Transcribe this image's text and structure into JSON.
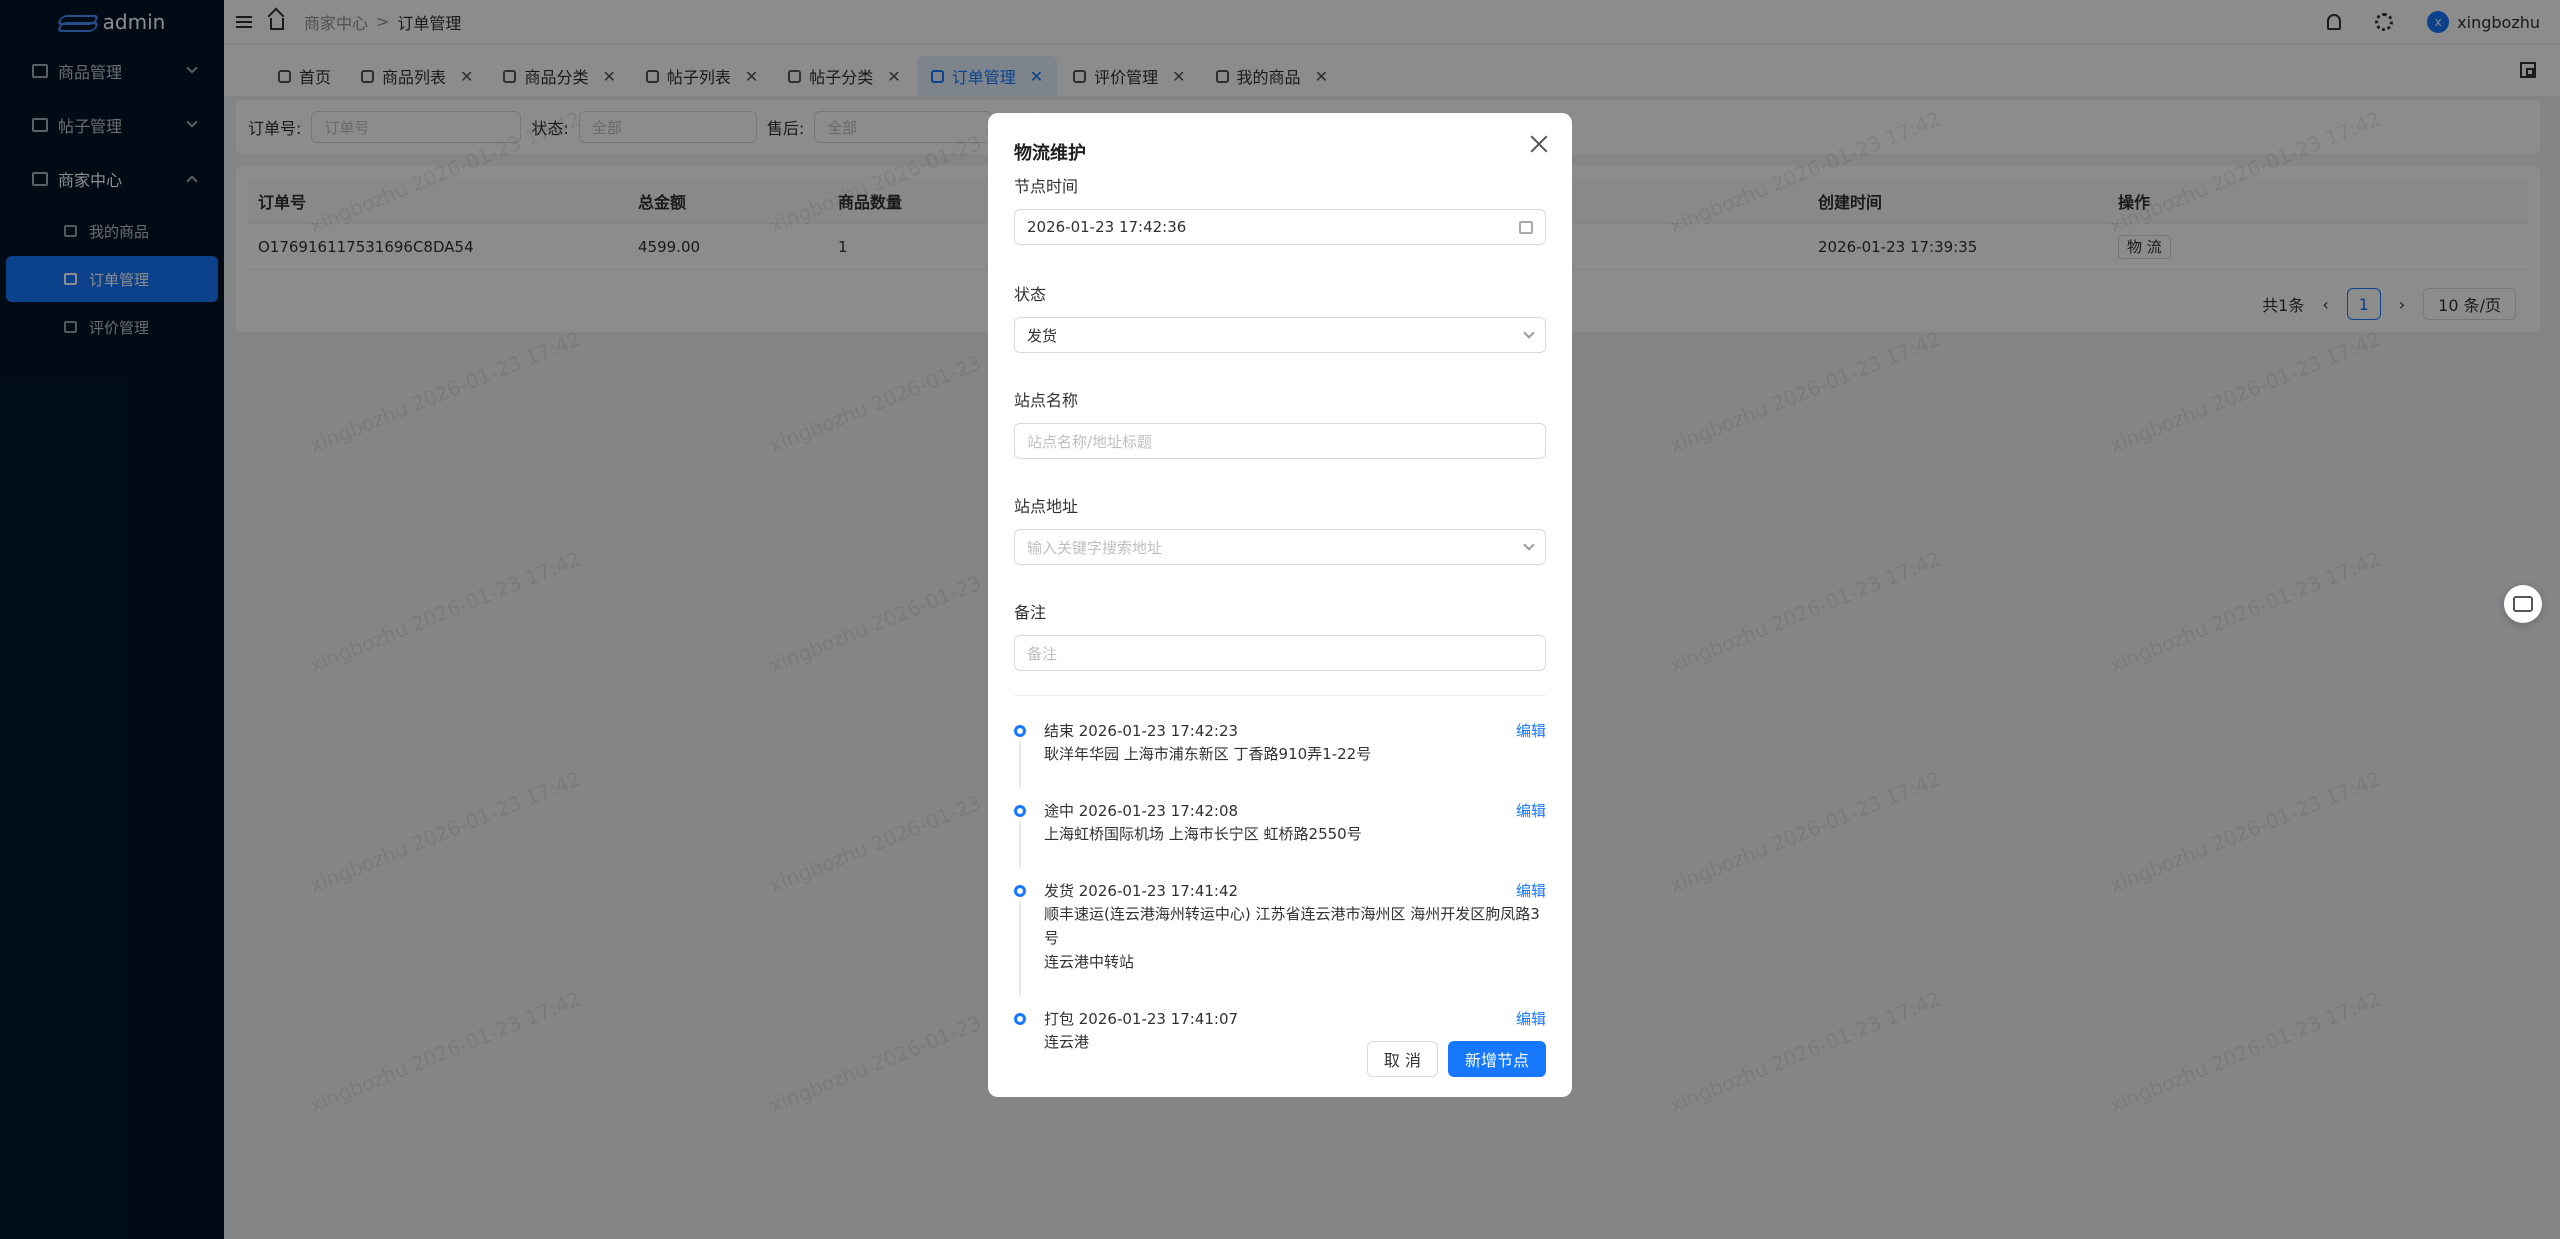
{
  "app": {
    "logo_text": "admin"
  },
  "sidebar": {
    "items": [
      {
        "label": "商品管理"
      },
      {
        "label": "帖子管理"
      },
      {
        "label": "商家中心"
      }
    ],
    "sub_items": [
      {
        "label": "我的商品"
      },
      {
        "label": "订单管理"
      },
      {
        "label": "评价管理"
      }
    ]
  },
  "header": {
    "breadcrumb": [
      "商家中心",
      ">",
      "订单管理"
    ],
    "username": "xingbozhu",
    "avatar_letter": "x"
  },
  "tabs": [
    {
      "label": "首页"
    },
    {
      "label": "商品列表"
    },
    {
      "label": "商品分类"
    },
    {
      "label": "帖子列表"
    },
    {
      "label": "帖子分类"
    },
    {
      "label": "订单管理"
    },
    {
      "label": "评价管理"
    },
    {
      "label": "我的商品"
    }
  ],
  "filter": {
    "order_no_label": "订单号:",
    "order_no_placeholder": "订单号",
    "status_label": "状态:",
    "status_value": "全部",
    "after_sale_label": "售后:",
    "after_sale_value": "全部"
  },
  "table": {
    "headers": [
      "订单号",
      "总金额",
      "商品数量",
      "创建时间",
      "操作"
    ],
    "rows": [
      [
        "O176916117531696C8DA54",
        "4599.00",
        "1",
        "2026-01-23 17:39:35",
        "物 流"
      ]
    ]
  },
  "pagination": {
    "total": "共1条",
    "current": "1",
    "page_size": "10 条/页"
  },
  "watermark": "xingbozhu 2026-01-23 17:42",
  "modal": {
    "title": "物流维护",
    "node_time_label": "节点时间",
    "node_time_value": "2026-01-23 17:42:36",
    "status_label": "状态",
    "status_value": "发货",
    "station_name_label": "站点名称",
    "station_name_placeholder": "站点名称/地址标题",
    "station_address_label": "站点地址",
    "station_address_placeholder": "输入关键字搜索地址",
    "remark_label": "备注",
    "remark_placeholder": "备注",
    "edit_label": "编辑",
    "timeline": [
      {
        "head": "结束 2026-01-23 17:42:23",
        "lines": [
          "耿洋年华园 上海市浦东新区 丁香路910弄1-22号"
        ]
      },
      {
        "head": "途中 2026-01-23 17:42:08",
        "lines": [
          "上海虹桥国际机场 上海市长宁区 虹桥路2550号"
        ]
      },
      {
        "head": "发货 2026-01-23 17:41:42",
        "lines": [
          "顺丰速运(连云港海州转运中心) 江苏省连云港市海州区 海州开发区朐凤路3号",
          "连云港中转站"
        ]
      },
      {
        "head": "打包 2026-01-23 17:41:07",
        "lines": [
          "连云港"
        ]
      }
    ],
    "cancel_label": "取 消",
    "add_label": "新增节点"
  }
}
